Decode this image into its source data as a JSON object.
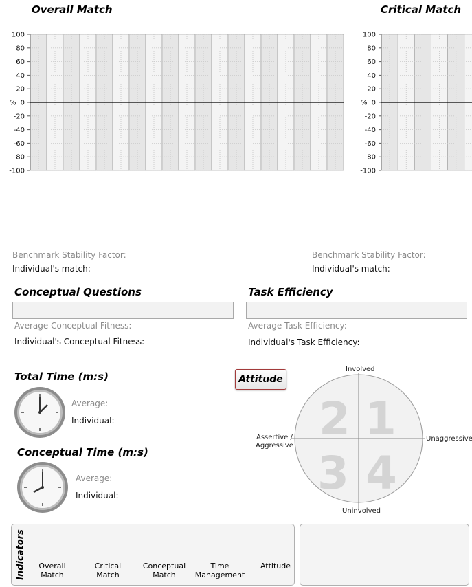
{
  "overall_chart": {
    "title": "Overall Match",
    "ylabel": "%",
    "yticks": [
      "100",
      "80",
      "60",
      "40",
      "20",
      "0",
      "-20",
      "-40",
      "-60",
      "-80",
      "-100"
    ]
  },
  "critical_chart": {
    "title": "Critical Match",
    "ylabel": "%",
    "yticks": [
      "100",
      "80",
      "60",
      "40",
      "20",
      "0",
      "-20",
      "-40",
      "-60",
      "-80",
      "-100"
    ]
  },
  "chart_data": [
    {
      "type": "bar",
      "title": "Overall Match",
      "ylabel": "%",
      "ylim": [
        -100,
        100
      ],
      "categories": [
        "",
        "",
        "",
        "",
        "",
        "",
        "",
        "",
        "",
        "",
        "",
        "",
        "",
        "",
        "",
        "",
        "",
        "",
        ""
      ],
      "values": [],
      "grid": true,
      "column_count": 19
    },
    {
      "type": "bar",
      "title": "Critical Match",
      "ylabel": "%",
      "ylim": [
        -100,
        100
      ],
      "categories": [
        "",
        "",
        "",
        "",
        "",
        ""
      ],
      "values": [],
      "grid": true,
      "column_count": 6
    }
  ],
  "benchmark_left": {
    "stability": "Benchmark Stability Factor:",
    "match": "Individual's match:"
  },
  "benchmark_right": {
    "stability": "Benchmark Stability Factor:",
    "match": "Individual's match:"
  },
  "conceptual": {
    "title": "Conceptual Questions",
    "average": "Average Conceptual Fitness:",
    "individual": "Individual's Conceptual Fitness:"
  },
  "task": {
    "title": "Task Efficiency",
    "average": "Average Task Efficiency:",
    "individual": "Individual's Task Efficiency:"
  },
  "total_time": {
    "title": "Total Time (m:s)",
    "average": "Average:",
    "individual": "Individual:"
  },
  "conceptual_time": {
    "title": "Conceptual Time (m:s)",
    "average": "Average:",
    "individual": "Individual:"
  },
  "attitude": {
    "button": "Attitude",
    "top": "Involved",
    "bottom": "Uninvolved",
    "left_line1": "Assertive /",
    "left_line2": "Aggressive",
    "right": "Unaggressive",
    "q1": "1",
    "q2": "2",
    "q3": "3",
    "q4": "4"
  },
  "indicators": {
    "title": "Indicators",
    "items": [
      {
        "line1": "Overall",
        "line2": "Match"
      },
      {
        "line1": "Critical",
        "line2": "Match"
      },
      {
        "line1": "Conceptual",
        "line2": "Match"
      },
      {
        "line1": "Time",
        "line2": "Management"
      },
      {
        "line1": "Attitude",
        "line2": ""
      }
    ]
  },
  "colors": {
    "band_dark": "#e6e6e6",
    "band_light": "#f4f4f4",
    "zero_line": "#000000",
    "accent_border": "#a33a3a"
  }
}
